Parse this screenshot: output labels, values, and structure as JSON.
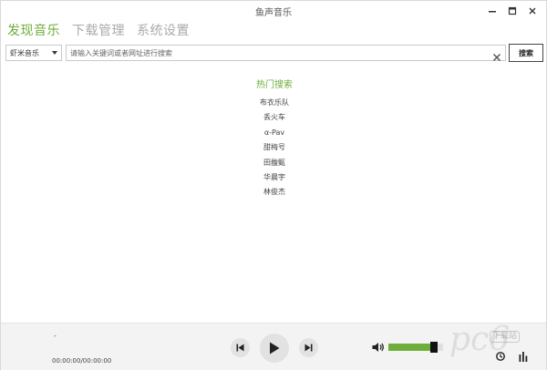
{
  "window": {
    "title": "鱼声音乐"
  },
  "tabs": [
    {
      "label": "发现音乐",
      "active": true
    },
    {
      "label": "下载管理",
      "active": false
    },
    {
      "label": "系统设置",
      "active": false
    }
  ],
  "search": {
    "source_selected": "虾米音乐",
    "placeholder": "请输入关键词或者网址进行搜索",
    "value": "",
    "button_label": "搜索"
  },
  "hot_search": {
    "title": "热门搜索",
    "items": [
      "布衣乐队",
      "丢火车",
      "α-Pav",
      "甜梅号",
      "田馥甄",
      "华晨宇",
      "林俊杰"
    ]
  },
  "player": {
    "track_title": "-",
    "time": "00:00:00/00:00:00",
    "volume_percent": 90
  },
  "watermark": {
    "logo_text": "pc6",
    "sub_text": "下载站"
  },
  "colors": {
    "accent": "#6fae3a",
    "player_bg": "#f3f3f3"
  }
}
